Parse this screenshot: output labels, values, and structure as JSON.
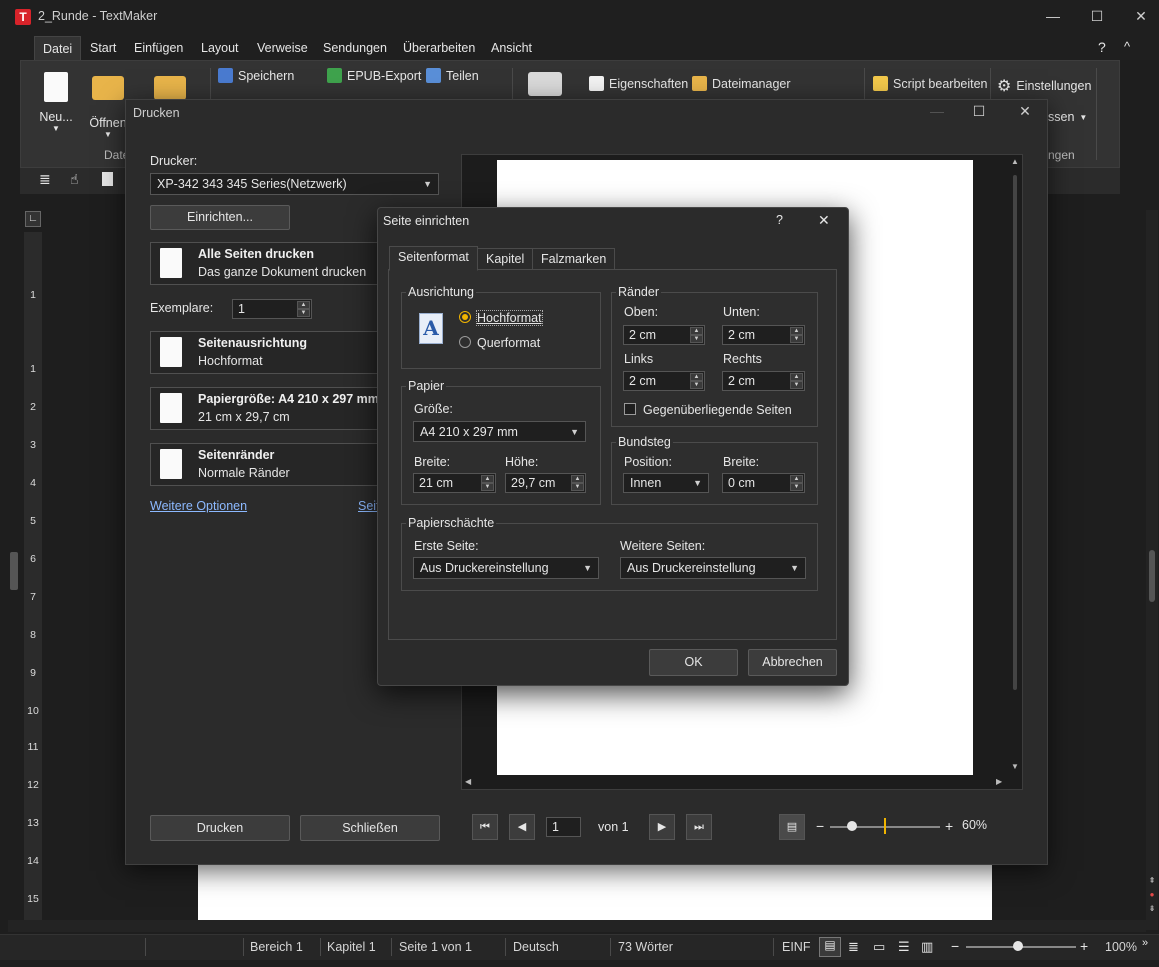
{
  "window": {
    "title": "2_Runde - TextMaker",
    "app_icon": "T",
    "minimize": "—",
    "maximize": "☐",
    "close": "✕"
  },
  "menu": {
    "tabs": [
      "Datei",
      "Start",
      "Einfügen",
      "Layout",
      "Verweise",
      "Sendungen",
      "Überarbeiten",
      "Ansicht"
    ],
    "help": "?",
    "collapse": "^"
  },
  "ribbon": {
    "new": "Neu...",
    "open": "Öffnen",
    "save": "Speichern",
    "epub": "EPUB-Export",
    "share": "Teilen",
    "properties": "Eigenschaften",
    "file_manager": "Dateimanager",
    "script": "Script bearbeiten",
    "settings": "Einstellungen",
    "group_file": "Datei",
    "group_right": "ngen",
    "right_cut": "ssen"
  },
  "ruler_numbers": [
    "1",
    "1",
    "2",
    "3",
    "4",
    "5",
    "6",
    "7",
    "8",
    "9",
    "10",
    "11",
    "12",
    "13",
    "14",
    "15"
  ],
  "status": {
    "area": "Bereich 1",
    "chapter": "Kapitel 1",
    "page": "Seite 1 von 1",
    "language": "Deutsch",
    "words": "73 Wörter",
    "mode": "EINF",
    "zoom": "100%",
    "zoom_minus": "−",
    "zoom_plus": "+"
  },
  "print_dialog": {
    "title": "Drucken",
    "printer_label": "Drucker:",
    "printer_value": "XP-342 343 345 Series(Netzwerk)",
    "setup_button": "Einrichten...",
    "all_pages_title": "Alle Seiten drucken",
    "all_pages_sub": "Das ganze Dokument drucken",
    "copies_label": "Exemplare:",
    "copies_value": "1",
    "orientation_title": "Seitenausrichtung",
    "orientation_sub": "Hochformat",
    "papersize_title": "Papiergröße: A4 210 x 297 mm",
    "papersize_sub": "21 cm x 29,7 cm",
    "margins_title": "Seitenränder",
    "margins_sub": "Normale Ränder",
    "more_options": "Weitere Optionen",
    "page_link": "Seit",
    "print_button": "Drucken",
    "close_button": "Schließen",
    "page_input": "1",
    "page_of": "von 1",
    "zoom_value": "60%",
    "zoom_minus": "−",
    "zoom_plus": "+"
  },
  "setup_dialog": {
    "title": "Seite einrichten",
    "help": "?",
    "close": "✕",
    "tabs": [
      "Seitenformat",
      "Kapitel",
      "Falzmarken"
    ],
    "orientation_group": "Ausrichtung",
    "portrait": "Hochformat",
    "landscape": "Querformat",
    "portrait_selected": true,
    "margins_group": "Ränder",
    "top_label": "Oben:",
    "top_value": "2 cm",
    "bottom_label": "Unten:",
    "bottom_value": "2 cm",
    "left_label": "Links",
    "left_value": "2 cm",
    "right_label": "Rechts",
    "right_value": "2 cm",
    "facing_pages": "Gegenüberliegende Seiten",
    "paper_group": "Papier",
    "size_label": "Größe:",
    "size_value": "A4 210 x 297 mm",
    "width_label": "Breite:",
    "width_value": "21 cm",
    "height_label": "Höhe:",
    "height_value": "29,7 cm",
    "gutter_group": "Bundsteg",
    "position_label": "Position:",
    "position_value": "Innen",
    "gutter_width_label": "Breite:",
    "gutter_width_value": "0 cm",
    "trays_group": "Papierschächte",
    "first_page_label": "Erste Seite:",
    "first_page_value": "Aus Druckereinstellung",
    "other_pages_label": "Weitere Seiten:",
    "other_pages_value": "Aus Druckereinstellung",
    "ok": "OK",
    "cancel": "Abbrechen"
  }
}
